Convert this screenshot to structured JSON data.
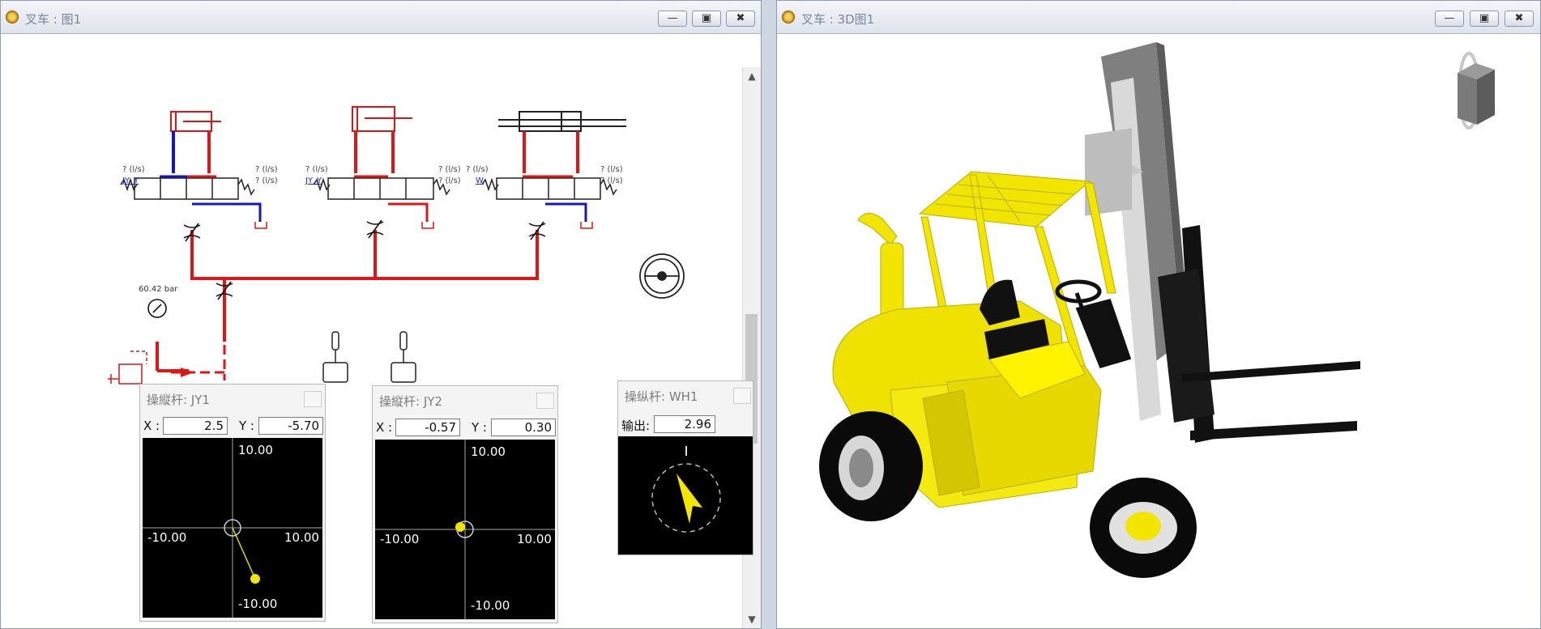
{
  "left_window": {
    "title": "叉车 : 图1",
    "gauge_label": "60.42 bar",
    "valve_labels": {
      "qls": "? (l/s)",
      "v1_link": "JY_Y",
      "v2_link": "JY_Y",
      "v3_link": "W"
    }
  },
  "right_window": {
    "title": "叉车 : 3D图1"
  },
  "joystick_jy1": {
    "title": "操縦杆:  JY1",
    "x_label": "X :",
    "x_value": "2.5",
    "y_label": "Y :",
    "y_value": "-5.70",
    "ticks": {
      "top": "10.00",
      "bottom": "-10.00",
      "left": "-10.00",
      "right": "10.00"
    }
  },
  "joystick_jy2": {
    "title": "操縦杆:  JY2",
    "x_label": "X :",
    "x_value": "-0.57",
    "y_label": "Y :",
    "y_value": "0.30",
    "ticks": {
      "top": "10.00",
      "bottom": "-10.00",
      "left": "-10.00",
      "right": "10.00"
    }
  },
  "wheel_wh1": {
    "title": "操纵杆:  WH1",
    "output_label": "输出:",
    "output_value": "2.96"
  },
  "colors": {
    "pressure_line": "#e01515",
    "return_line": "#1414c8",
    "forklift_body": "#f2e500",
    "mast": "#d8d8d8"
  }
}
